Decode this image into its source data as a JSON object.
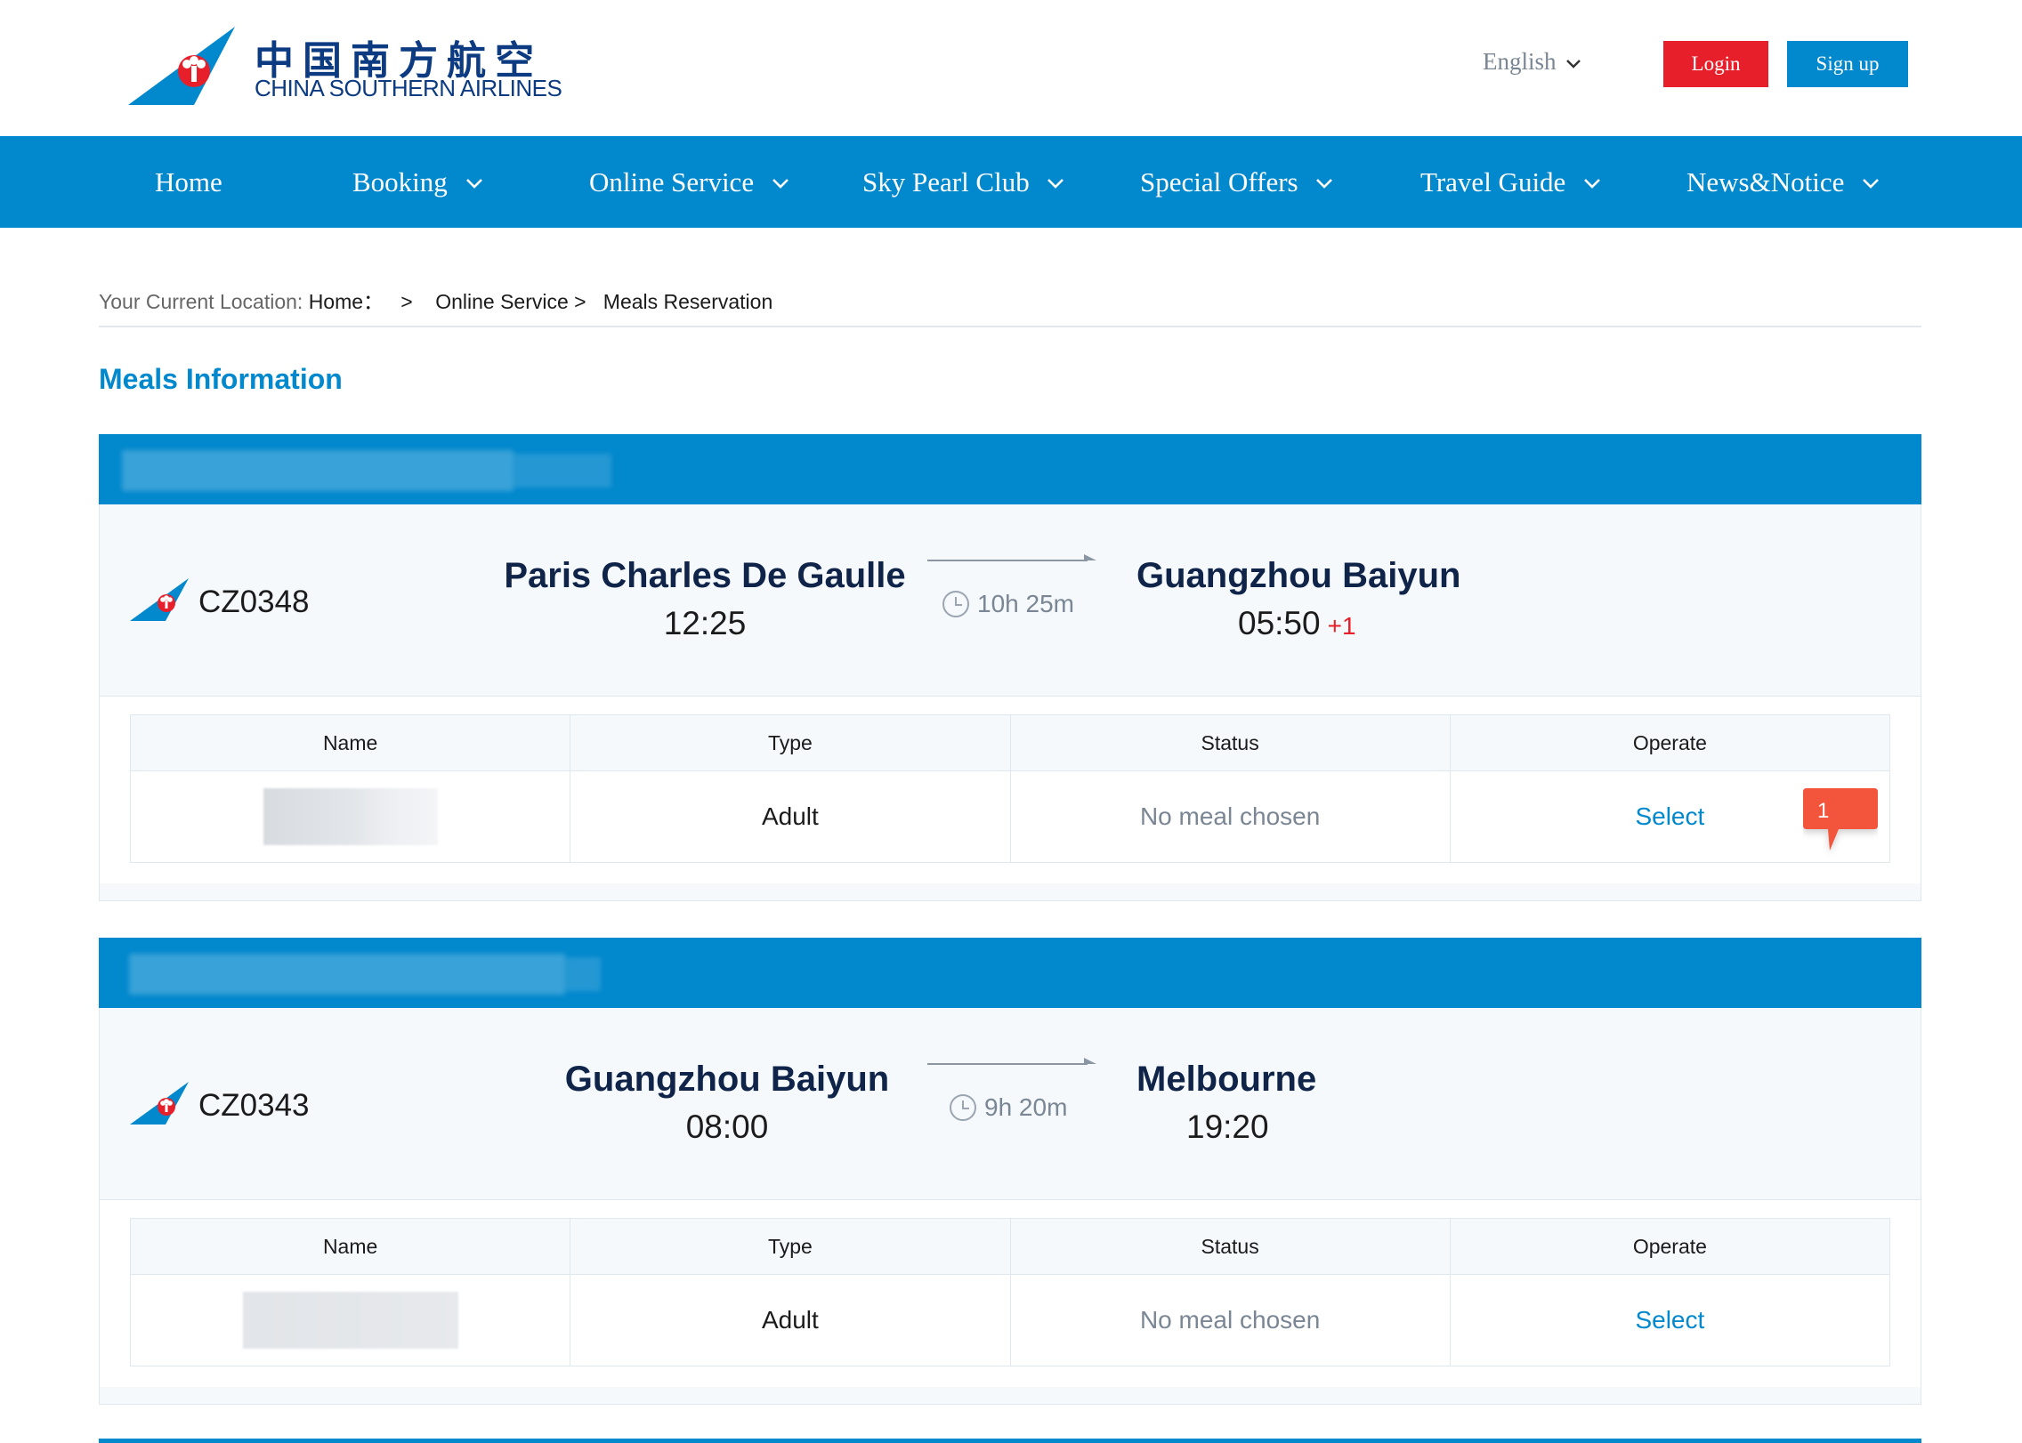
{
  "header": {
    "logo_cn": "中国南方航空",
    "logo_en": "CHINA SOUTHERN AIRLINES",
    "language": "English",
    "login_label": "Login",
    "signup_label": "Sign up"
  },
  "nav": {
    "items": [
      {
        "label": "Home",
        "has_dropdown": false
      },
      {
        "label": "Booking",
        "has_dropdown": true
      },
      {
        "label": "Online Service",
        "has_dropdown": true
      },
      {
        "label": "Sky Pearl Club",
        "has_dropdown": true
      },
      {
        "label": "Special Offers",
        "has_dropdown": true
      },
      {
        "label": "Travel Guide",
        "has_dropdown": true
      },
      {
        "label": "News&Notice",
        "has_dropdown": true
      }
    ]
  },
  "breadcrumb": {
    "prefix": "Your Current Location:",
    "home": "Home：",
    "sep1": ">",
    "online_service": "Online Service >",
    "current": "Meals Reservation"
  },
  "page_title": "Meals Information",
  "table_headers": {
    "name": "Name",
    "type": "Type",
    "status": "Status",
    "operate": "Operate"
  },
  "flights": [
    {
      "flight_no": "CZ0348",
      "origin": "Paris Charles De Gaulle",
      "depart_time": "12:25",
      "duration": "10h 25m",
      "destination": "Guangzhou Baiyun",
      "arrive_time": "05:50",
      "day_offset": "+1",
      "passenger": {
        "type": "Adult",
        "status": "No meal chosen",
        "action": "Select"
      }
    },
    {
      "flight_no": "CZ0343",
      "origin": "Guangzhou Baiyun",
      "depart_time": "08:00",
      "duration": "9h 20m",
      "destination": "Melbourne",
      "arrive_time": "19:20",
      "day_offset": "",
      "passenger": {
        "type": "Adult",
        "status": "No meal chosen",
        "action": "Select"
      }
    }
  ],
  "notification_badge": "1",
  "colors": {
    "brand_blue": "#0288cd",
    "logo_navy": "#0c3b82",
    "login_red": "#e71f2a",
    "badge_orange": "#f2553a",
    "card_bg": "#f5f9fc"
  },
  "icons": [
    "logo-bird-icon",
    "chevron-down-icon",
    "clock-icon",
    "arrow-right-icon",
    "notification-bubble-icon"
  ]
}
